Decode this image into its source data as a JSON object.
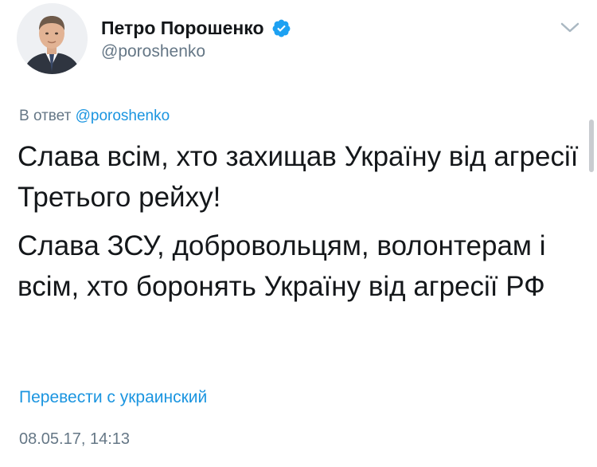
{
  "author": {
    "display_name": "Петро Порошенко",
    "handle": "@poroshenko",
    "verified": true,
    "avatar_icon": "profile-photo",
    "verified_icon": "verified-badge-icon"
  },
  "reply": {
    "prefix": "В ответ",
    "mention": "@poroshenko"
  },
  "tweet": {
    "paragraphs": [
      "Слава всім, хто захищав Україну від агресії Третього рейху!",
      "Слава ЗСУ, добровольцям, волонтерам і всім, хто боронять Україну від агресії РФ"
    ]
  },
  "translate_link": "Перевести с украинский",
  "timestamp": "08.05.17, 14:13",
  "colors": {
    "accent": "#1b95e0",
    "secondary_text": "#657786",
    "primary_text": "#14171a"
  }
}
